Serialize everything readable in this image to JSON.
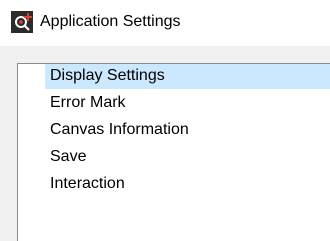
{
  "window": {
    "title": "Application Settings",
    "icon": "application-settings-icon"
  },
  "settings_list": {
    "items": [
      {
        "label": "Display Settings",
        "selected": true
      },
      {
        "label": "Error Mark",
        "selected": false
      },
      {
        "label": "Canvas Information",
        "selected": false
      },
      {
        "label": "Save",
        "selected": false
      },
      {
        "label": "Interaction",
        "selected": false
      }
    ]
  },
  "colors": {
    "selection": "#cce8ff",
    "icon_background": "#2b2b2b",
    "icon_accent": "#e0403a"
  }
}
